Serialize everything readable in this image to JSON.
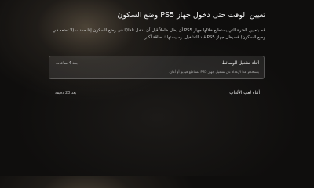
{
  "page": {
    "title": "تعيين الوقت حتى دخول جهاز PS5 وضع السكون",
    "description": "قم بتعيين الفترة التي يستطيع خلالها جهاز PS5 أن يظل خاملاً قبل أن يدخل تلقائيًا في وضع السكون إذا حددت (لا تضعه في وضع السكون) فسيظل جهاز PS5 قيد التشغيل، وسيستهلك طاقة أكبر."
  },
  "options": [
    {
      "label": "أثناء تشغيل الوسائط",
      "value": "بعد 4 ساعات",
      "subtext": "يستخدم هذا الإعداد عن تشغيل جهاز PS5 لمقاطع فيديو أو أغانٍ."
    },
    {
      "label": "أثناء لعب الألعاب",
      "value": "بعد 20 دقيقة"
    }
  ]
}
